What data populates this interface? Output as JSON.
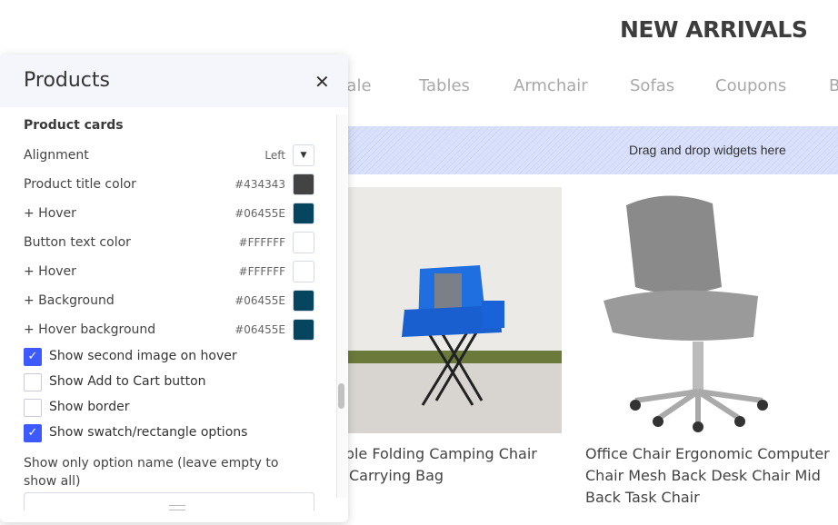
{
  "page": {
    "title": "NEW ARRIVALS",
    "tabs": [
      "Sale",
      "Tables",
      "Armchair",
      "Sofas",
      "Coupons",
      "B"
    ],
    "dropzone": "Drag and drop widgets here",
    "products": [
      {
        "title_lines": [
          "able Folding Camping Chair",
          "Carrying Bag"
        ]
      },
      {
        "title_lines": [
          "Office Chair Ergonomic Computer",
          "Chair Mesh Back Desk Chair Mid",
          "Back Task Chair"
        ]
      }
    ]
  },
  "panel": {
    "title": "Products",
    "close_icon": "close-icon",
    "section": "Product cards",
    "alignment": {
      "label": "Alignment",
      "value": "Left"
    },
    "colors": [
      {
        "label": "Product title color",
        "value": "#434343"
      },
      {
        "label": "+ Hover",
        "value": "#06455E"
      },
      {
        "label": "Button text color",
        "value": "#FFFFFF"
      },
      {
        "label": "+ Hover",
        "value": "#FFFFFF"
      },
      {
        "label": "+ Background",
        "value": "#06455E"
      },
      {
        "label": "+ Hover background",
        "value": "#06455E"
      }
    ],
    "checkboxes": [
      {
        "label": "Show second image on hover",
        "checked": true
      },
      {
        "label": "Show Add to Cart button",
        "checked": false
      },
      {
        "label": "Show border",
        "checked": false
      },
      {
        "label": "Show swatch/rectangle options",
        "checked": true
      }
    ],
    "option_name_label": "Show only option name (leave empty to show all)",
    "option_name_value": ""
  },
  "accent": "#3d5afe"
}
